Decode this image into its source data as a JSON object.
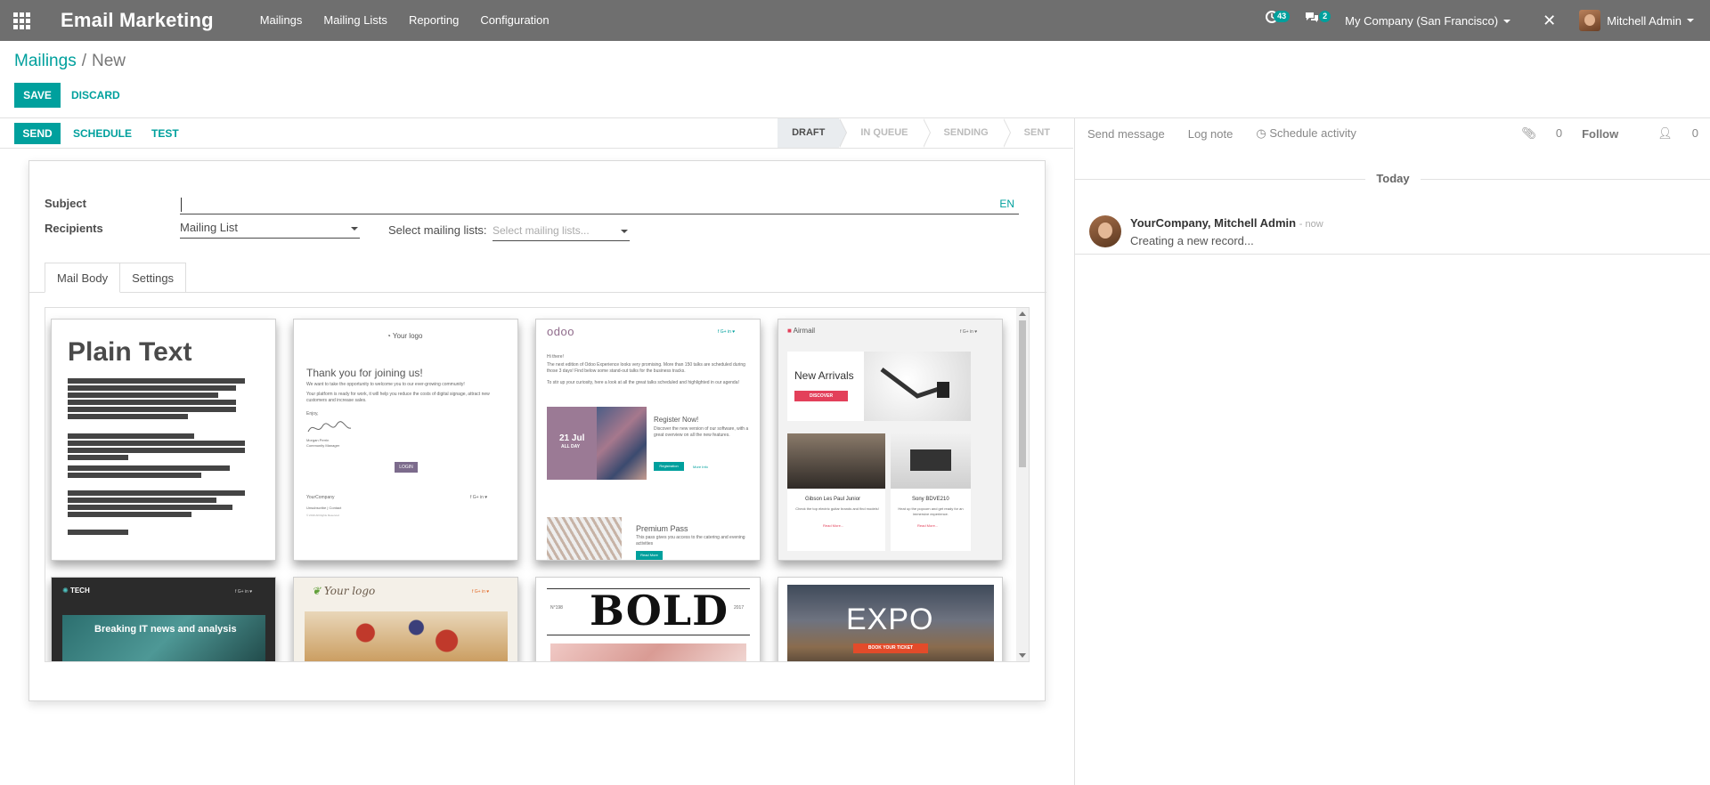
{
  "navbar": {
    "app_title": "Email Marketing",
    "menu": [
      "Mailings",
      "Mailing Lists",
      "Reporting",
      "Configuration"
    ],
    "activity_count": "43",
    "message_count": "2",
    "company": "My Company (San Francisco)",
    "user": "Mitchell Admin"
  },
  "breadcrumb": {
    "parent": "Mailings",
    "separator": "/",
    "current": "New"
  },
  "buttons": {
    "save": "SAVE",
    "discard": "DISCARD",
    "send": "SEND",
    "schedule": "SCHEDULE",
    "test": "TEST"
  },
  "stages": [
    "DRAFT",
    "IN QUEUE",
    "SENDING",
    "SENT"
  ],
  "active_stage": "DRAFT",
  "form": {
    "subject_label": "Subject",
    "subject_value": "",
    "lang": "EN",
    "recipients_label": "Recipients",
    "recipients_value": "Mailing List",
    "mailing_lists_label": "Select mailing lists:",
    "mailing_lists_placeholder": "Select mailing lists...",
    "tabs": [
      "Mail Body",
      "Settings"
    ]
  },
  "templates": {
    "plain": {
      "title": "Plain Text"
    },
    "welcome": {
      "logo": "Your logo",
      "title": "Thank you for joining us!",
      "line1": "We want to take the opportunity to welcome you to our ever-growing community!",
      "line2": "Your platform is ready for work, it will help you reduce the costs of digital signage, attract new customers and increase sales.",
      "enjoy": "Enjoy,",
      "signer": "Morgan Perrin",
      "signer_role": "Community Manager",
      "button": "LOGIN",
      "company": "YourCompany",
      "links": "Unsubscribe | Contact",
      "copyright": "© 2019 All Rights Reserved"
    },
    "event": {
      "logo": "odoo",
      "greeting": "Hi there!",
      "intro": "The next edition of Odoo Experience looks very promising. More than 150 talks are scheduled during those 3 days! Find below some stand-out talks for the business tracks.",
      "intro2": "To stir up your curiosity, here a look at all the great talks scheduled and highlighted in our agenda!",
      "date": "21 Jul",
      "day": "ALL DAY",
      "register_title": "Register Now!",
      "register_text": "Discover the new version of our software, with a great overview on all the new features.",
      "register_btn": "Registration",
      "more_info": "More Info",
      "pass_title": "Premium Pass",
      "pass_text": "This pass gives you access to the catering and evening activities",
      "read_more": "Read More"
    },
    "airmail": {
      "logo": "Airmail",
      "headline": "New Arrivals",
      "button": "DISCOVER",
      "product1": "Gibson Les Paul Junior",
      "product1_text": "Check the top electric guitar brands and find models!",
      "product2": "Sony BDVE210",
      "product2_text": "Heat up the popcorn and get ready for an immersive experience.",
      "read_more": "Read More..."
    },
    "tech": {
      "logo": "TECH",
      "headline": "Breaking IT news and analysis"
    },
    "food": {
      "logo": "Your logo"
    },
    "bold": {
      "title": "BOLD",
      "issue": "N°198",
      "date": "2017"
    },
    "expo": {
      "title": "EXPO",
      "button": "BOOK YOUR TICKET"
    }
  },
  "chatter": {
    "send_message": "Send message",
    "log_note": "Log note",
    "schedule_activity": "Schedule activity",
    "attachments": "0",
    "follow": "Follow",
    "followers": "0",
    "today": "Today",
    "author": "YourCompany, Mitchell Admin",
    "time": "- now",
    "body": "Creating a new record..."
  },
  "colors": {
    "accent": "#00a09d",
    "navbar": "#6f6f6f"
  }
}
